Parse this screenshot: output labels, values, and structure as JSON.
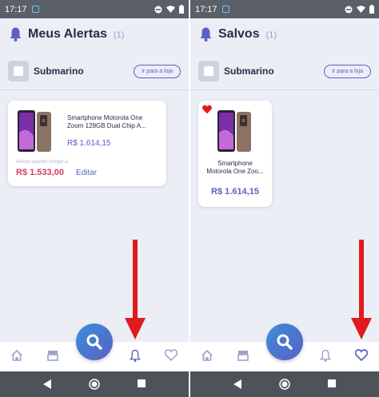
{
  "left": {
    "status_time": "17:17",
    "title": "Meus Alertas",
    "count": "(1)",
    "store": {
      "name": "Submarino",
      "button": "Ir para a loja"
    },
    "product": {
      "name_line1": "Smartphone Motorola One",
      "name_line2": "Zoom 128GB Dual Chip A...",
      "price": "R$ 1.614,15",
      "alert_label": "Alertar quando chegar a:",
      "alert_price": "R$ 1.533,00",
      "edit": "Editar"
    }
  },
  "right": {
    "status_time": "17:17",
    "title": "Salvos",
    "count": "(1)",
    "store": {
      "name": "Submarino",
      "button": "Ir para a loja"
    },
    "product": {
      "name_line1": "Smartphone",
      "name_line2": "Motorola One Zoo...",
      "price": "R$ 1.614,15"
    }
  },
  "colors": {
    "accent": "#5a60c4",
    "alert_price": "#d43c68",
    "arrow": "#e01b1b",
    "fab_gradient": [
      "#3a8fd8",
      "#5a60c4"
    ]
  },
  "nav": {
    "items": [
      "home-icon",
      "store-icon",
      "search-icon",
      "bell-icon",
      "heart-icon"
    ]
  }
}
